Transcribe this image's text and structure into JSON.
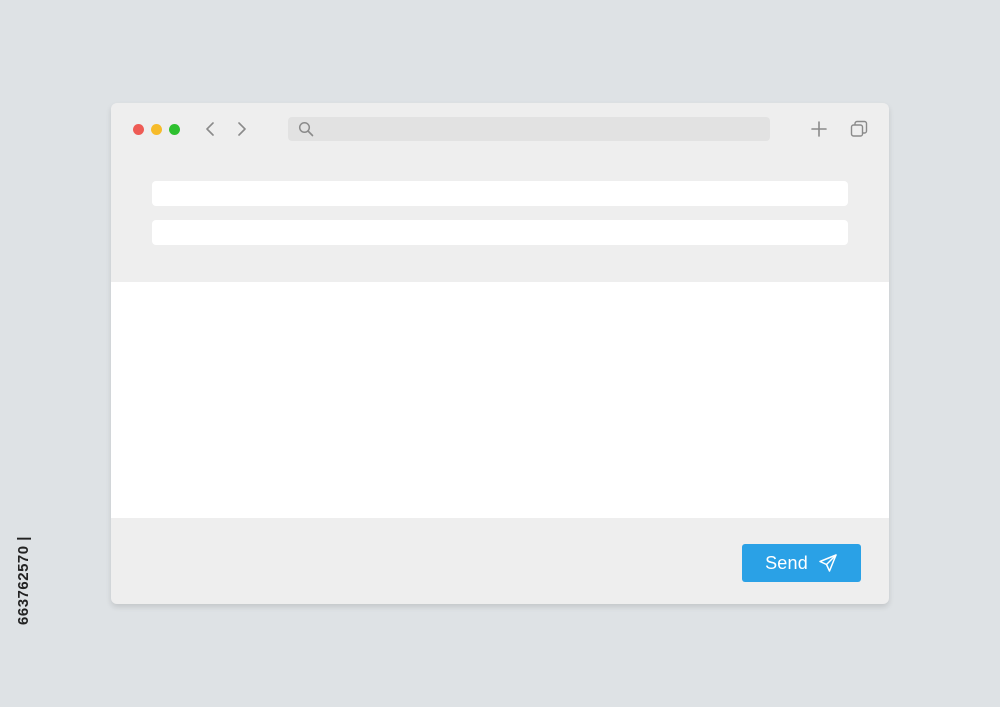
{
  "colors": {
    "page_background": "#dee2e5",
    "window_background": "#eeeeee",
    "content_background": "#ffffff",
    "address_bar": "#e2e2e2",
    "dot_red": "#ee5b55",
    "dot_yellow": "#f6bb2a",
    "dot_green": "#2ec02f",
    "icon_gray": "#8a8a8a",
    "send_button": "#2aa1e6"
  },
  "window_controls": {
    "icons": [
      "close-dot",
      "minimize-dot",
      "maximize-dot"
    ]
  },
  "toolbar": {
    "back_icon": "chevron-left",
    "forward_icon": "chevron-right",
    "search_icon": "magnifier",
    "new_tab_icon": "plus",
    "tabs_icon": "copy-windows"
  },
  "address_bar": {
    "value": "",
    "placeholder": ""
  },
  "form": {
    "field_1": {
      "value": "",
      "placeholder": ""
    },
    "field_2": {
      "value": "",
      "placeholder": ""
    },
    "message": {
      "value": "",
      "placeholder": ""
    }
  },
  "send_button": {
    "label": "Send",
    "icon": "paper-plane"
  },
  "side_text": "663762570 |"
}
